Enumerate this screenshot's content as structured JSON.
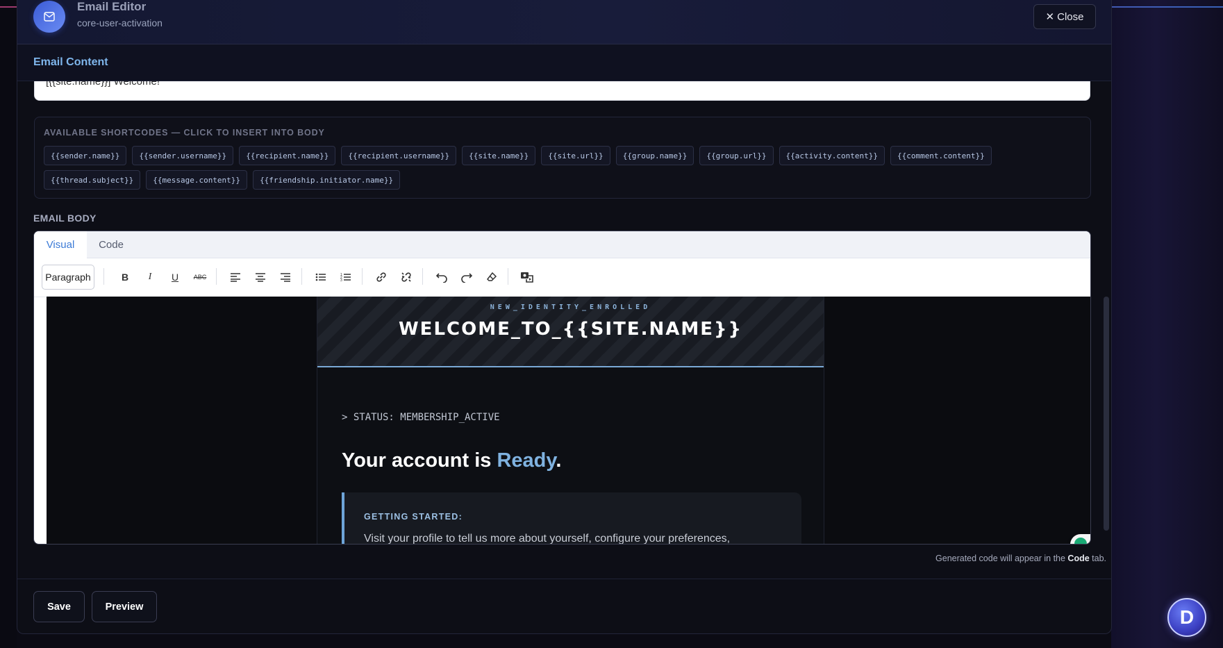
{
  "window": {
    "title": "Email Editor",
    "subtitle": "core-user-activation",
    "close_label": "Close"
  },
  "section_tab": "Email Content",
  "subject": {
    "value": "[{{site.name}}] Welcome!"
  },
  "shortcodes": {
    "title": "AVAILABLE SHORTCODES — CLICK TO INSERT INTO BODY",
    "items": [
      "{{sender.name}}",
      "{{sender.username}}",
      "{{recipient.name}}",
      "{{recipient.username}}",
      "{{site.name}}",
      "{{site.url}}",
      "{{group.name}}",
      "{{group.url}}",
      "{{activity.content}}",
      "{{comment.content}}",
      "{{thread.subject}}",
      "{{message.content}}",
      "{{friendship.initiator.name}}"
    ]
  },
  "body": {
    "label": "EMAIL BODY",
    "tabs": [
      "Visual",
      "Code"
    ],
    "active_tab": "Visual",
    "format": "Paragraph",
    "toolbar_icons": [
      "bold-icon",
      "italic-icon",
      "underline-icon",
      "strikethrough-icon",
      "align-left-icon",
      "align-center-icon",
      "align-right-icon",
      "bullet-list-icon",
      "numbered-list-icon",
      "link-icon",
      "unlink-icon",
      "undo-icon",
      "redo-icon",
      "clear-format-icon",
      "media-icon"
    ],
    "toolbar_labels": {
      "bold": "B",
      "italic": "I",
      "underline": "U",
      "strike": "ABC"
    }
  },
  "preview": {
    "kicker": "NEW_IDENTITY_ENROLLED",
    "title": "WELCOME_TO_{{SITE.NAME}}",
    "status": "> STATUS: MEMBERSHIP_ACTIVE",
    "headline_start": "Your account is ",
    "headline_accent": "Ready",
    "headline_end": ".",
    "callout_title": "GETTING STARTED:",
    "callout_text": "Visit your profile to tell us more about yourself, configure your preferences,"
  },
  "note": {
    "prefix": "Generated code will appear in the ",
    "bold": "Code",
    "suffix": " tab."
  },
  "footer": {
    "save_label": "Save",
    "preview_label": "Preview"
  },
  "assistant": {
    "letter": "D"
  },
  "colors": {
    "accent": "#7fb6ec",
    "hero_border": "#7aa9d6",
    "brand_avatar": "#3b5bd6"
  }
}
